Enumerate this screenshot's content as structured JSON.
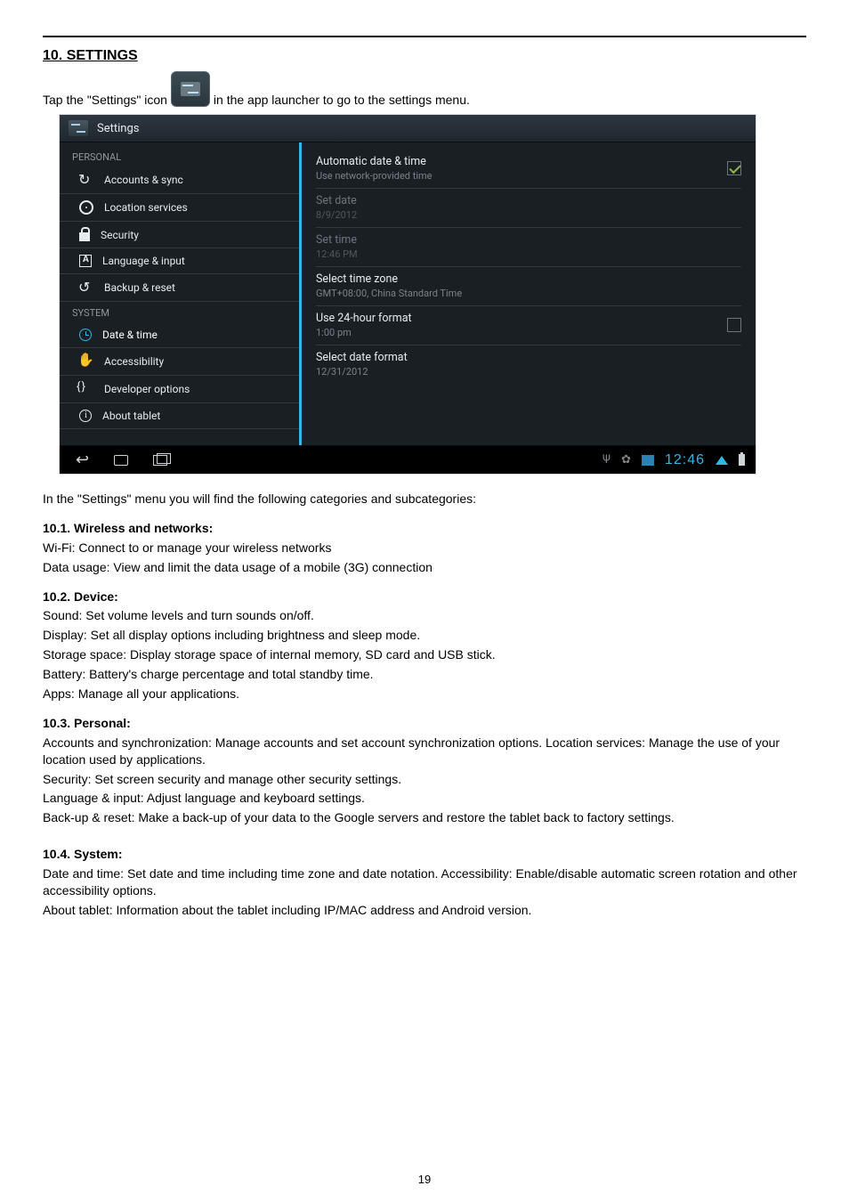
{
  "heading": "10. SETTINGS",
  "intro": {
    "pre": "Tap the \"Settings\" icon",
    "post": "in the app launcher to go to the settings menu."
  },
  "screenshot": {
    "title": "Settings",
    "left": {
      "section_personal": "PERSONAL",
      "section_system": "SYSTEM",
      "items": {
        "accounts": "Accounts & sync",
        "location": "Location services",
        "security": "Security",
        "language": "Language & input",
        "backup": "Backup & reset",
        "datetime": "Date & time",
        "accessibility": "Accessibility",
        "developer": "Developer options",
        "about": "About tablet"
      }
    },
    "right": {
      "auto": {
        "title": "Automatic date & time",
        "sub": "Use network-provided time",
        "checked": true
      },
      "setdate": {
        "title": "Set date",
        "sub": "8/9/2012"
      },
      "settime": {
        "title": "Set time",
        "sub": "12:46 PM"
      },
      "tz": {
        "title": "Select time zone",
        "sub": "GMT+08:00, China Standard Time"
      },
      "fmt24": {
        "title": "Use 24-hour format",
        "sub": "1:00 pm",
        "checked": false
      },
      "datefmt": {
        "title": "Select date format",
        "sub": "12/31/2012"
      }
    },
    "status": {
      "clock": "12:46"
    }
  },
  "after_screenshot": "In the \"Settings\" menu you will find the following categories and subcategories:",
  "sections": {
    "s101": {
      "title": "10.1. Wireless and networks:",
      "l1": "Wi-Fi: Connect to or manage your wireless networks",
      "l2": "Data usage: View and limit the data usage of a mobile (3G) connection"
    },
    "s102": {
      "title": "10.2. Device:",
      "l1": "Sound: Set volume levels and turn sounds on/off.",
      "l2": "Display: Set all display options including brightness and sleep mode.",
      "l3": "Storage space: Display storage space of internal memory, SD card and USB stick.",
      "l4": "Battery: Battery's charge percentage and total standby time.",
      "l5": "Apps: Manage all your applications."
    },
    "s103": {
      "title": "10.3. Personal:",
      "l1": "Accounts and synchronization: Manage accounts and set account synchronization options. Location services: Manage the use of your location used by applications.",
      "l2": "Security: Set screen security and manage other security settings.",
      "l3": "Language & input: Adjust language and keyboard settings.",
      "l4": "Back-up & reset: Make a back-up of your data to the Google servers and restore the tablet back to factory settings."
    },
    "s104": {
      "title": "10.4. System:",
      "l1": "Date and time: Set date and time including time zone and date notation. Accessibility: Enable/disable automatic screen rotation and other accessibility options.",
      "l2": "About tablet: Information about the tablet including IP/MAC address and Android version."
    }
  },
  "page_number": "19"
}
